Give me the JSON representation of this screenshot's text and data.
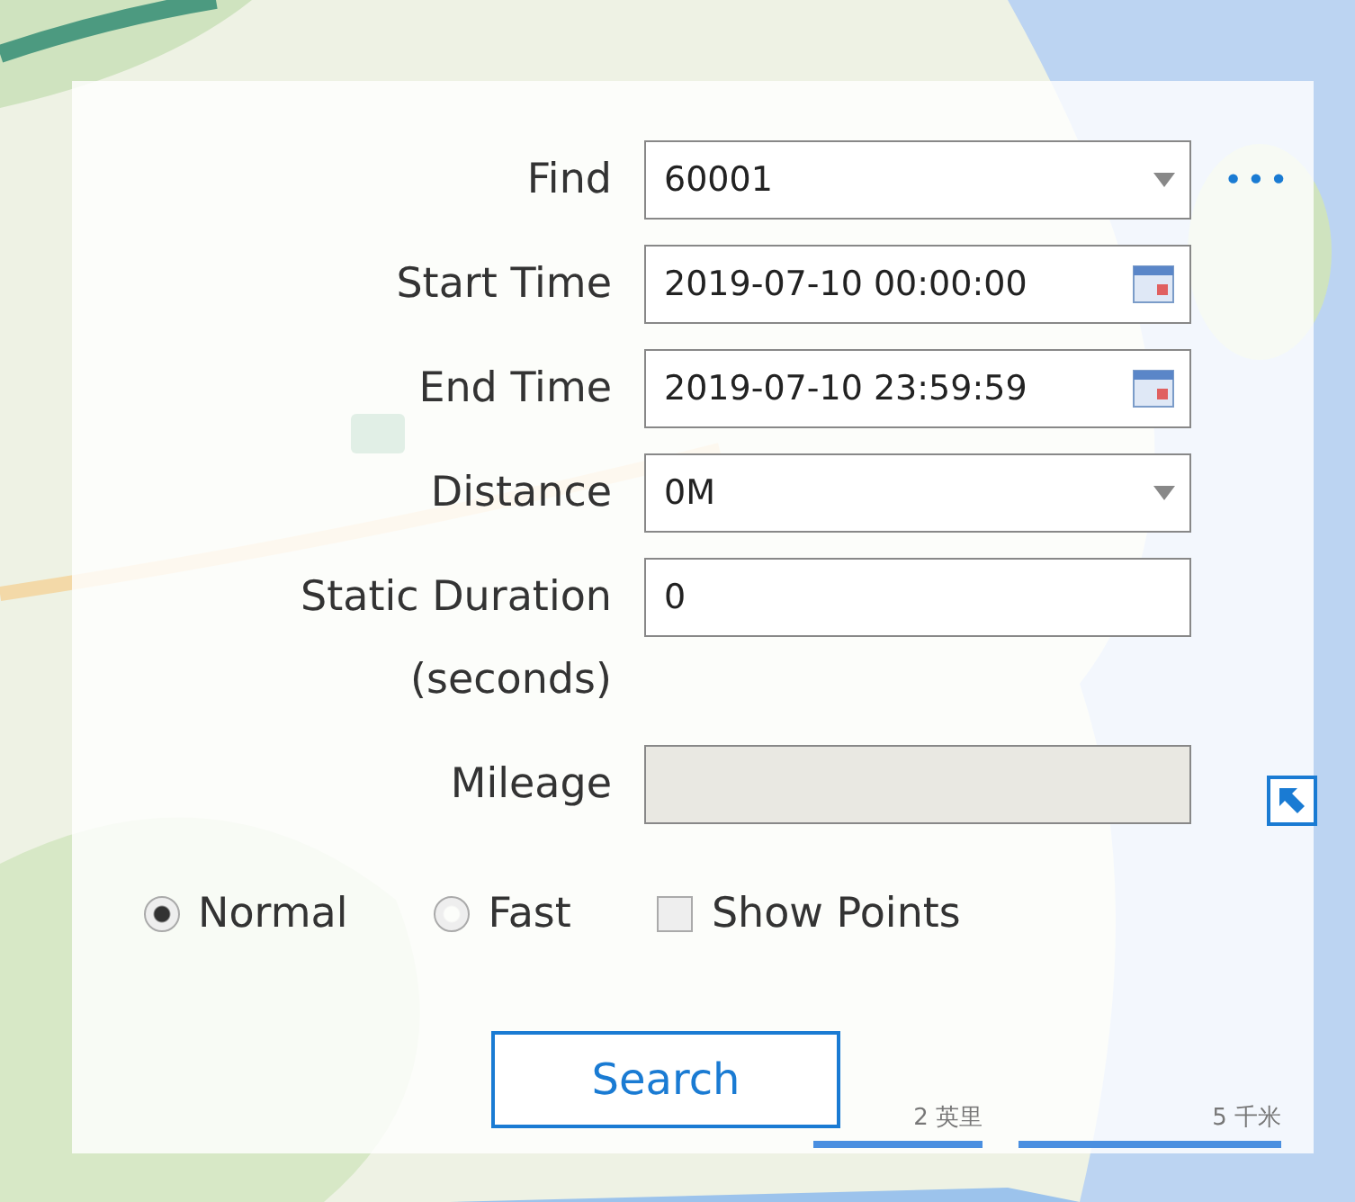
{
  "form": {
    "fields": [
      {
        "kind": "select",
        "label": "Find",
        "value": "60001",
        "more": "•••"
      },
      {
        "kind": "date",
        "label": "Start Time",
        "value": "2019-07-10 00:00:00"
      },
      {
        "kind": "date",
        "label": "End Time",
        "value": "2019-07-10 23:59:59"
      },
      {
        "kind": "select",
        "label": "Distance",
        "value": "0M"
      },
      {
        "kind": "text",
        "label": "Static Duration (seconds)",
        "value": "0"
      },
      {
        "kind": "readonly",
        "label": "Mileage"
      }
    ],
    "options": [
      {
        "kind": "radio",
        "label": "Normal",
        "selected": true
      },
      {
        "kind": "radio",
        "label": "Fast",
        "selected": false
      },
      {
        "kind": "checkbox",
        "label": "Show Points",
        "checked": false
      }
    ],
    "search_button": "Search"
  },
  "map": {
    "kind": "picture",
    "scale": [
      "2 英里",
      "5 千米"
    ]
  }
}
